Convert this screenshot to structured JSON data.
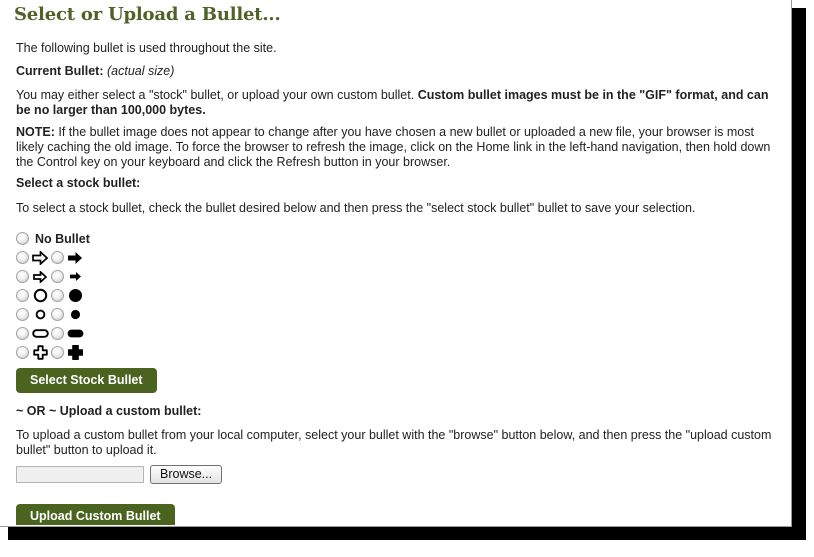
{
  "page": {
    "title": "Select or Upload a Bullet...",
    "title_color": "#4f6228",
    "accent_button_color": "#4a6420"
  },
  "intro": {
    "line": "The following bullet is used throughout the site."
  },
  "current_bullet": {
    "label": "Current Bullet:",
    "note": "(actual size)"
  },
  "formats": {
    "text_normal": "You may either select a \"stock\" bullet, or upload your own custom bullet. ",
    "text_bold": "Custom bullet images must be in the \"GIF\" format, and can be no larger than 100,000 bytes."
  },
  "note": {
    "label": "NOTE:",
    "text": " If the bullet image does not appear to change after you have chosen a new bullet or uploaded a new file, your browser is most likely caching the old image. To force the browser to refresh the image, click on the Home link in the left-hand navigation, then hold down the Control key on your keyboard and click the Refresh button in your browser."
  },
  "stock_section": {
    "heading": "Select a stock bullet:",
    "instructions": "To select a stock bullet, check the bullet desired below and then press the \"select stock bullet\" bullet to save your selection.",
    "no_bullet_label": "No Bullet",
    "select_button_label": "Select Stock Bullet",
    "rows": [
      {
        "left_icon": "arrow-right-outline-large",
        "right_icon": "arrow-right-filled-large"
      },
      {
        "left_icon": "arrow-right-outline-small",
        "right_icon": "arrow-right-filled-small"
      },
      {
        "left_icon": "circle-outline-large",
        "right_icon": "circle-filled-large"
      },
      {
        "left_icon": "circle-outline-small",
        "right_icon": "circle-filled-small"
      },
      {
        "left_icon": "pill-outline",
        "right_icon": "pill-filled"
      },
      {
        "left_icon": "cross-outline",
        "right_icon": "cross-filled"
      }
    ]
  },
  "upload_section": {
    "heading": "~ OR ~ Upload a custom bullet:",
    "instructions": "To upload a custom bullet from your local computer, select your bullet with the \"browse\" button below, and then press the \"upload custom bullet\" button to upload it.",
    "file_input_value": "",
    "file_input_placeholder": "",
    "browse_button_label": "Browse...",
    "upload_button_label": "Upload Custom Bullet"
  }
}
